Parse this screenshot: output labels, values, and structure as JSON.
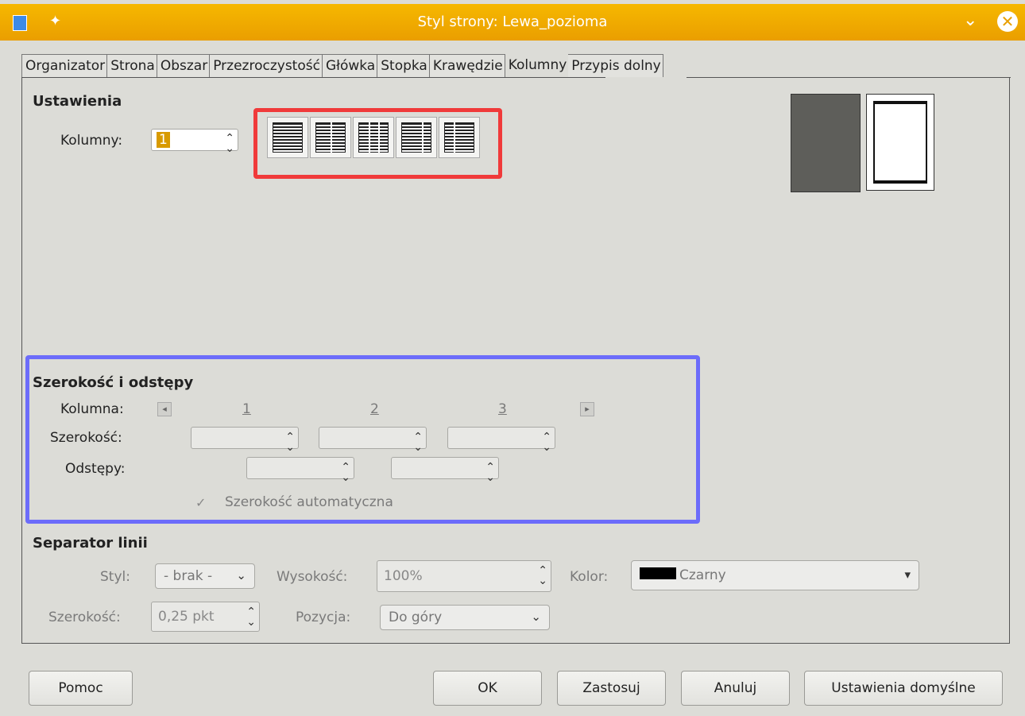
{
  "window": {
    "title": "Styl strony: Lewa_pozioma"
  },
  "tabs": [
    {
      "label": "Organizator"
    },
    {
      "label": "Strona"
    },
    {
      "label": "Obszar"
    },
    {
      "label": "Przezroczystość"
    },
    {
      "label": "Główka"
    },
    {
      "label": "Stopka"
    },
    {
      "label": "Krawędzie"
    },
    {
      "label": "Kolumny"
    },
    {
      "label": "Przypis dolny"
    }
  ],
  "settings": {
    "heading": "Ustawienia",
    "columns_label": "Kolumny:",
    "columns_value": "1"
  },
  "width_spacing": {
    "heading": "Szerokość i odstępy",
    "column_label": "Kolumna:",
    "col_numbers": [
      "1",
      "2",
      "3"
    ],
    "width_label": "Szerokość:",
    "spacing_label": "Odstępy:",
    "auto_width_label": "Szerokość automatyczna",
    "auto_width_checked": true
  },
  "separator": {
    "heading": "Separator linii",
    "style_label": "Styl:",
    "style_value": "- brak -",
    "height_label": "Wysokość:",
    "height_value": "100%",
    "color_label": "Kolor:",
    "color_value": "Czarny",
    "color_hex": "#000000",
    "width_label": "Szerokość:",
    "width_value": "0,25 pkt",
    "position_label": "Pozycja:",
    "position_value": "Do góry"
  },
  "buttons": {
    "help": "Pomoc",
    "ok": "OK",
    "apply": "Zastosuj",
    "cancel": "Anuluj",
    "defaults": "Ustawienia domyślne"
  }
}
